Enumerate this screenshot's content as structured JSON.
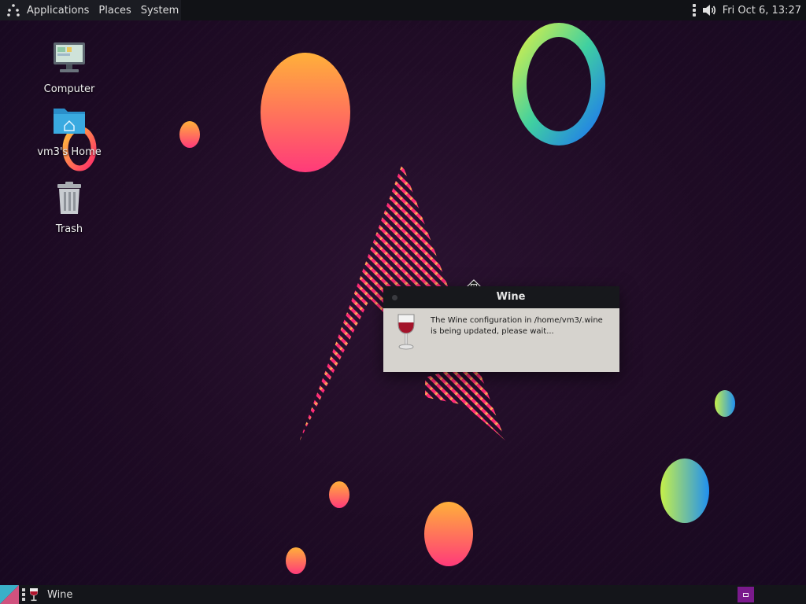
{
  "top_panel": {
    "menus": {
      "applications": "Applications",
      "places": "Places",
      "system": "System"
    },
    "clock": "Fri Oct  6, 13:27",
    "icons": {
      "apps": "arch-menu-icon",
      "handle": "panel-handle-icon",
      "volume": "volume-icon"
    }
  },
  "desktop": {
    "icons": [
      {
        "label": "Computer",
        "icon": "computer-icon"
      },
      {
        "label": "vm3's Home",
        "icon": "home-folder-icon"
      },
      {
        "label": "Trash",
        "icon": "trash-icon"
      }
    ]
  },
  "dialog": {
    "title": "Wine",
    "message": "The Wine configuration in /home/vm3/.wine is being updated, please wait...",
    "icon": "wine-glass-icon"
  },
  "taskbar": {
    "task_label": "Wine",
    "task_icon": "wine-glass-icon",
    "workspace_color": "#7a1a8c"
  },
  "colors": {
    "background": "#1e0b24",
    "panel": "#111216",
    "dialog_body": "#d6d3ce",
    "accent_pink": "#e8246f",
    "accent_orange": "#ffb03a"
  }
}
